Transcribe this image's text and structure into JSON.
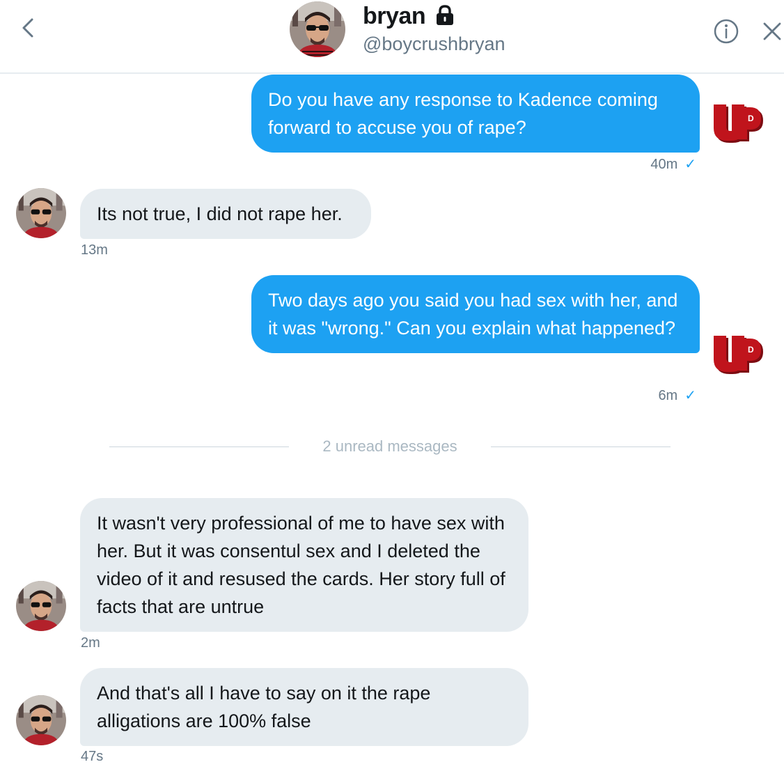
{
  "header": {
    "name": "bryan",
    "handle": "@boycrushbryan",
    "icons": [
      "chevron-left-icon",
      "lock-icon",
      "info-icon",
      "close-icon"
    ]
  },
  "messages": [
    {
      "direction": "outgoing",
      "text": "Do you have any response to Kadence coming forward to accuse you of rape?",
      "time": "40m",
      "status": "✓"
    },
    {
      "direction": "incoming",
      "text": "Its not true, I did not rape her.",
      "time": "13m"
    },
    {
      "direction": "outgoing",
      "text": "Two days ago you said you had sex with her, and it was \"wrong.\" Can you explain what happened?",
      "time": "6m",
      "status": "✓"
    },
    {
      "direction": "incoming",
      "text": "It wasn't very professional of me to have sex with her. But it was consentul sex and I deleted the video of it and resused the cards. Her story full of facts that are untrue",
      "time": "2m"
    },
    {
      "direction": "incoming",
      "text": "And that's all I have to say on it the rape alligations are 100% false",
      "time": "47s"
    }
  ],
  "divider": {
    "text": "2 unread messages"
  },
  "colors": {
    "outgoing_bubble": "#1da1f2",
    "incoming_bubble": "#e6ecf0",
    "meta_text": "#657786",
    "logo_red": "#c0141c"
  }
}
